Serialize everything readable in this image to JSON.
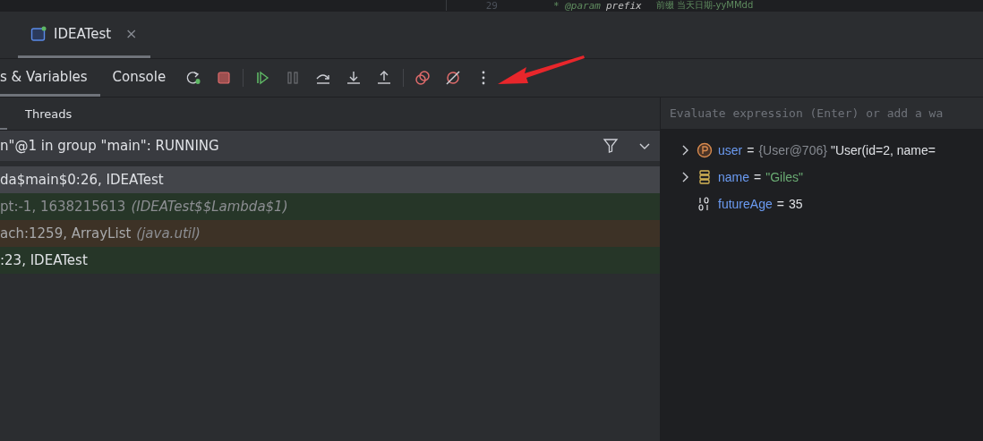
{
  "editor": {
    "line_number": "29",
    "tag": "* @param",
    "param": "prefix",
    "description": "前缀 当天日期-yyMMdd"
  },
  "tabs": [
    {
      "label": "IDEATest",
      "selected": true,
      "close": "×"
    }
  ],
  "debug_tabs": [
    {
      "label": "s & Variables",
      "selected": true
    },
    {
      "label": "Console",
      "selected": false
    }
  ],
  "toolbar": [
    {
      "kind": "rerun",
      "disabled": false
    },
    {
      "kind": "stop",
      "disabled": false
    },
    {
      "kind": "resume",
      "disabled": false
    },
    {
      "kind": "pause",
      "disabled": true
    },
    {
      "kind": "step-over",
      "disabled": false
    },
    {
      "kind": "step-into",
      "disabled": false
    },
    {
      "kind": "step-out",
      "disabled": false
    },
    {
      "kind": "breakpoints",
      "disabled": false
    },
    {
      "kind": "mute",
      "disabled": false
    },
    {
      "kind": "more",
      "disabled": false
    }
  ],
  "sub_tabs": [
    {
      "label": "Threads",
      "selected": false
    }
  ],
  "thread_selector": {
    "value": "n\"@1 in group \"main\": RUNNING"
  },
  "frames": [
    {
      "text": "da$main$0:26, IDEATest",
      "kind": "selected"
    },
    {
      "text": "pt:-1, 1638215613",
      "detail": "(IDEATest$$Lambda$1)",
      "kind": "project"
    },
    {
      "text": "ach:1259, ArrayList",
      "detail": "(java.util)",
      "kind": "library"
    },
    {
      "text": ":23, IDEATest",
      "kind": "project"
    }
  ],
  "evaluate": {
    "placeholder": "Evaluate expression (Enter) or add a wa"
  },
  "variables": [
    {
      "kind": "object",
      "expandable": true,
      "name": "user",
      "eq": "=",
      "type": "{User@706}",
      "value": "\"User(id=2, name="
    },
    {
      "kind": "field",
      "expandable": true,
      "name": "name",
      "eq": "=",
      "string_value": "\"Giles\""
    },
    {
      "kind": "primitive",
      "expandable": false,
      "name": "futureAge",
      "eq": "=",
      "value": "35"
    }
  ]
}
